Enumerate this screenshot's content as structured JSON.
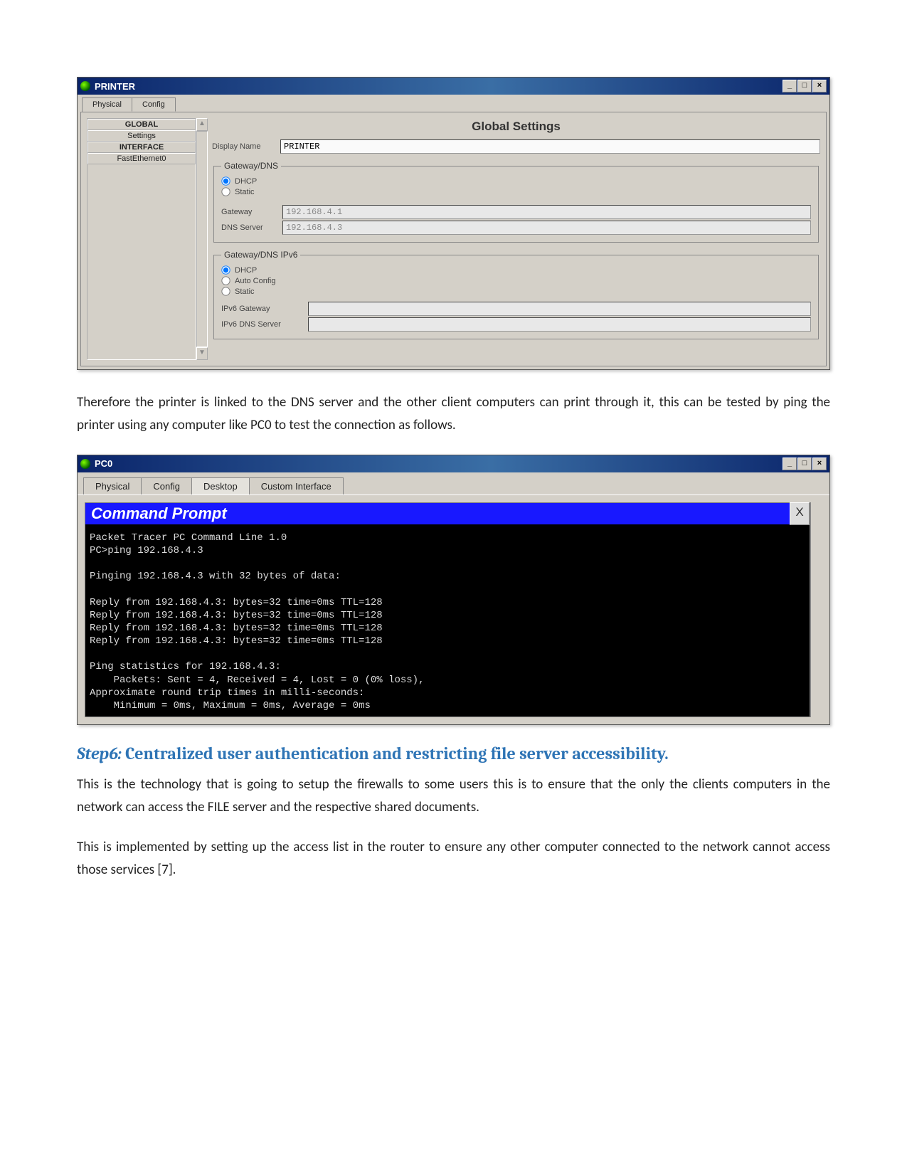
{
  "printerWindow": {
    "title": "PRINTER",
    "tabs": [
      "Physical",
      "Config"
    ],
    "activeTab": "Config",
    "sidebar": {
      "headers": [
        "GLOBAL",
        "INTERFACE"
      ],
      "global_items": [
        "Settings"
      ],
      "interface_items": [
        "FastEthernet0"
      ]
    },
    "panel_title": "Global Settings",
    "displayName_label": "Display Name",
    "displayName_value": "PRINTER",
    "gw4": {
      "legend": "Gateway/DNS",
      "dhcp": "DHCP",
      "static": "Static",
      "gateway_label": "Gateway",
      "gateway_value": "192.168.4.1",
      "dns_label": "DNS Server",
      "dns_value": "192.168.4.3"
    },
    "gw6": {
      "legend": "Gateway/DNS IPv6",
      "dhcp": "DHCP",
      "auto": "Auto Config",
      "static": "Static",
      "gateway_label": "IPv6 Gateway",
      "gateway_value": "",
      "dns_label": "IPv6 DNS Server",
      "dns_value": ""
    }
  },
  "para1": "Therefore the printer is linked to the DNS server and the other client computers can print through it, this can be tested by ping the printer using any computer like PC0 to test the connection as follows.",
  "pc0Window": {
    "title": "PC0",
    "tabs": [
      "Physical",
      "Config",
      "Desktop",
      "Custom Interface"
    ],
    "activeTab": "Desktop",
    "cmd_title": "Command Prompt",
    "cmd_close": "X",
    "terminal": "Packet Tracer PC Command Line 1.0\nPC>ping 192.168.4.3\n\nPinging 192.168.4.3 with 32 bytes of data:\n\nReply from 192.168.4.3: bytes=32 time=0ms TTL=128\nReply from 192.168.4.3: bytes=32 time=0ms TTL=128\nReply from 192.168.4.3: bytes=32 time=0ms TTL=128\nReply from 192.168.4.3: bytes=32 time=0ms TTL=128\n\nPing statistics for 192.168.4.3:\n    Packets: Sent = 4, Received = 4, Lost = 0 (0% loss),\nApproximate round trip times in milli-seconds:\n    Minimum = 0ms, Maximum = 0ms, Average = 0ms"
  },
  "step6": {
    "label": "Step6:",
    "text": " Centralized  user authentication and restricting file server accessibility."
  },
  "para2": "This is the technology that is going to setup the firewalls to some users this is to ensure that the only the clients computers in the network can access the FILE server and the respective shared documents.",
  "para3": "This is implemented by setting up the access list in the router to ensure any other computer connected to the network cannot access those services [7].",
  "winbtns": {
    "min": "_",
    "max": "□",
    "close": "×"
  }
}
